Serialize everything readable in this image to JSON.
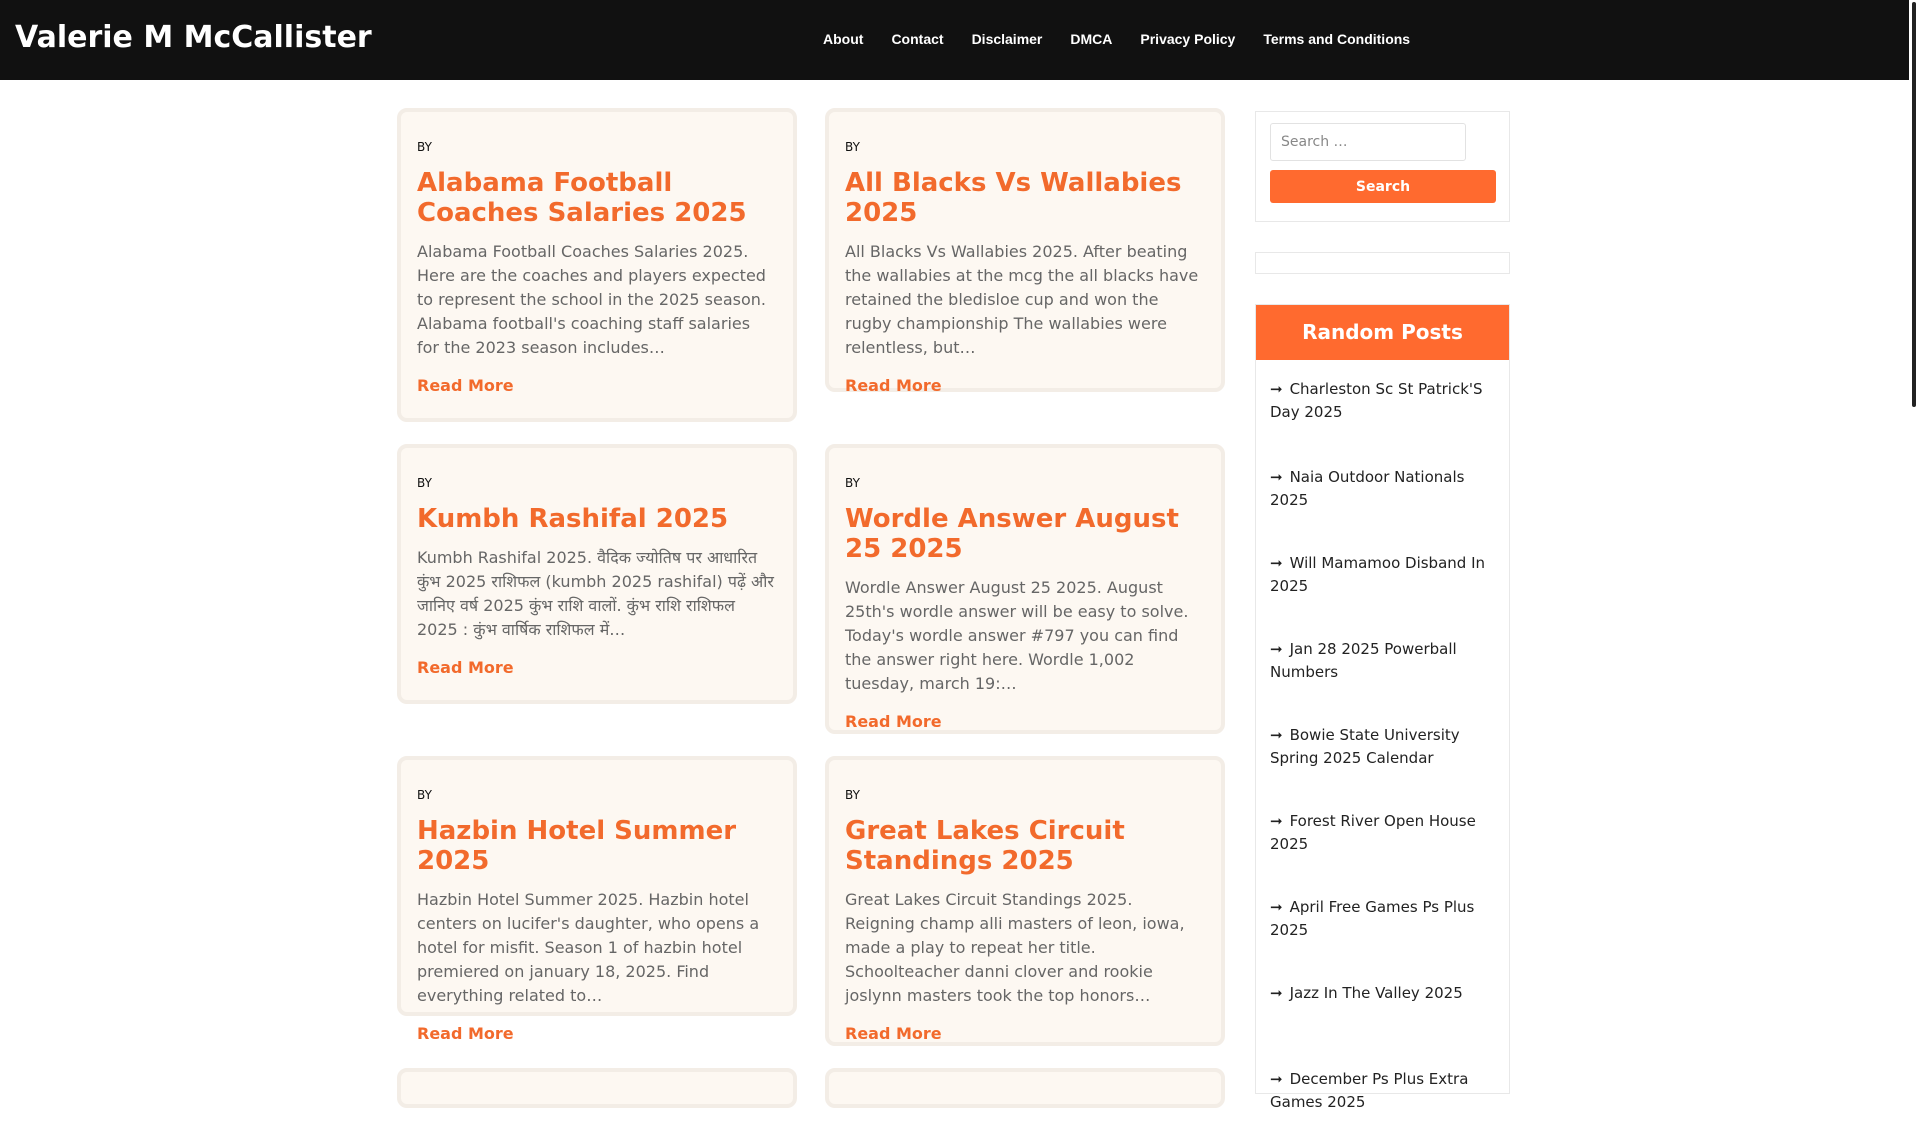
{
  "site": {
    "title": "Valerie M McCallister"
  },
  "nav": {
    "items": [
      "About",
      "Contact",
      "Disclaimer",
      "DMCA",
      "Privacy Policy",
      "Terms and Conditions"
    ]
  },
  "posts": [
    {
      "by": "BY",
      "title": "Alabama Football Coaches Salaries 2025",
      "excerpt": "Alabama Football Coaches Salaries 2025. Here are the coaches and players expected to represent the school in the 2025 season. Alabama football's coaching staff salaries for the 2023 season includes…",
      "more": "Read More"
    },
    {
      "by": "BY",
      "title": "All Blacks Vs Wallabies 2025",
      "excerpt": "All Blacks Vs Wallabies 2025. After beating the wallabies at the mcg the all blacks have retained the bledisloe cup and won the rugby championship The wallabies were relentless, but…",
      "more": "Read More"
    },
    {
      "by": "BY",
      "title": "Kumbh Rashifal 2025",
      "excerpt": "Kumbh Rashifal 2025. वैदिक ज्योतिष पर आधारित कुंभ 2025 राशिफल (kumbh 2025 rashifal) पढ़ें और जानिए वर्ष 2025 कुंभ राशि वालों. कुंभ राशि राशिफल 2025 : कुंभ वार्षिक राशिफल में…",
      "more": "Read More"
    },
    {
      "by": "BY",
      "title": "Wordle Answer August 25 2025",
      "excerpt": "Wordle Answer August 25 2025. August 25th's wordle answer will be easy to solve. Today's wordle answer #797 you can find the answer right here. Wordle 1,002 tuesday, march 19:…",
      "more": "Read More"
    },
    {
      "by": "BY",
      "title": "Hazbin Hotel Summer 2025",
      "excerpt": "Hazbin Hotel Summer 2025. Hazbin hotel centers on lucifer's daughter, who opens a hotel for misfit. Season 1 of hazbin hotel premiered on january 18, 2025. Find everything related to…",
      "more": "Read More"
    },
    {
      "by": "BY",
      "title": "Great Lakes Circuit Standings 2025",
      "excerpt": "Great Lakes Circuit Standings 2025. Reigning champ alli masters of leon, iowa, made a play to repeat her title. Schoolteacher danni clover and rookie joslynn masters took the top honors…",
      "more": "Read More"
    }
  ],
  "search": {
    "placeholder": "Search …",
    "button": "Search"
  },
  "random": {
    "title": "Random Posts",
    "arrow": "➞",
    "items": [
      "Charleston Sc St Patrick'S Day 2025",
      "Naia Outdoor Nationals 2025",
      "Will Mamamoo Disband In 2025",
      "Jan 28 2025 Powerball Numbers",
      "Bowie State University Spring 2025 Calendar",
      "Forest River Open House 2025",
      "April Free Games Ps Plus 2025",
      "Jazz In The Valley 2025",
      "December Ps Plus Extra Games 2025"
    ]
  },
  "colors": {
    "accent": "#ff6a2f",
    "title": "#f26a2c",
    "header_bg": "#111111",
    "card_bg": "#fdf8f2"
  }
}
